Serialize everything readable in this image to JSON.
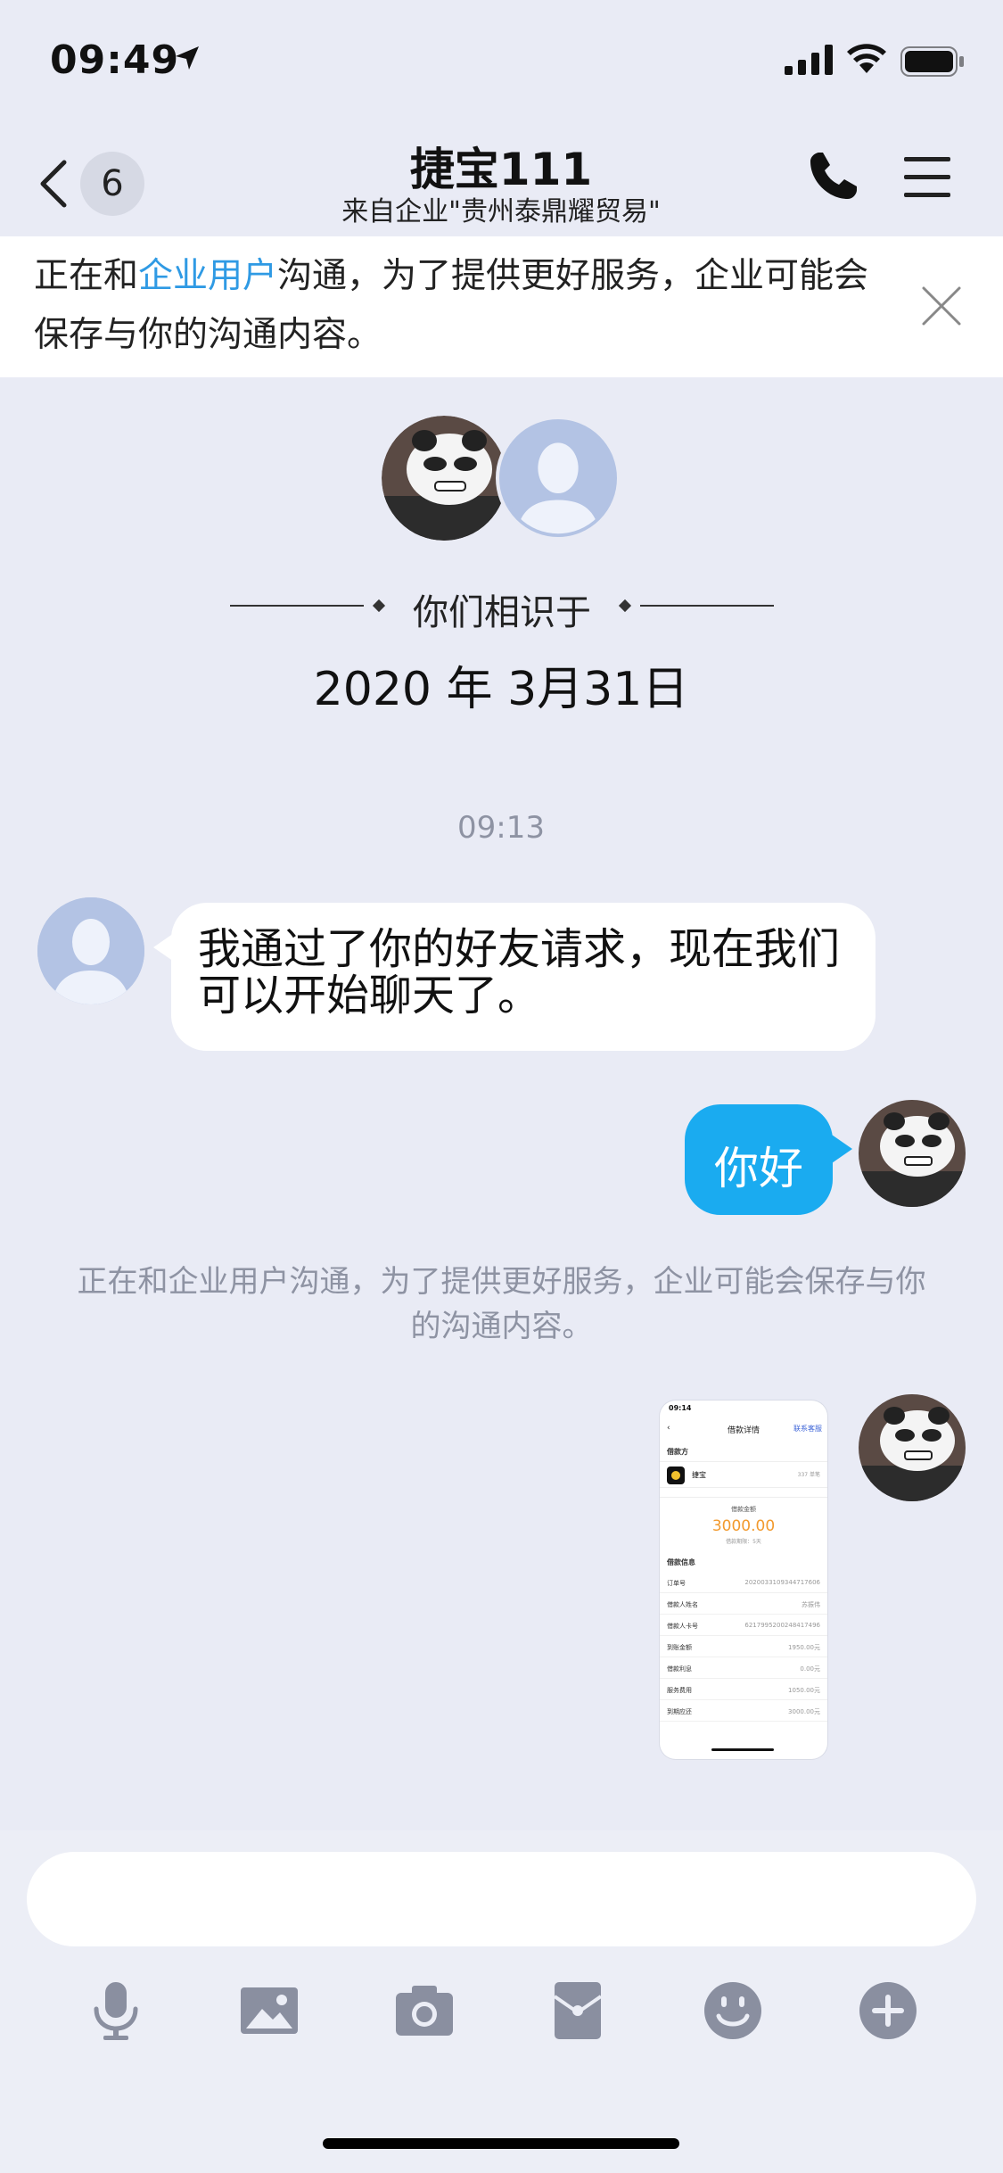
{
  "status_bar": {
    "time": "09:49"
  },
  "nav": {
    "unread_count": "6",
    "title": "捷宝111",
    "subtitle": "来自企业\"贵州泰鼎耀贸易\""
  },
  "notice": {
    "prefix": "正在和",
    "link": "企业用户",
    "suffix": "沟通，为了提供更好服务，企业可能会保存与你的沟通内容。"
  },
  "met": {
    "label": "你们相识于",
    "date": "2020 年 3月31日"
  },
  "chat": {
    "timestamp": "09:13",
    "incoming_message": "我通过了你的好友请求，现在我们可以开始聊天了。",
    "outgoing_message": "你好",
    "system_note": "正在和企业用户沟通，为了提供更好服务，企业可能会保存与你的沟通内容。"
  },
  "shared_screenshot": {
    "status_time": "09:14",
    "title": "借款详情",
    "action": "联系客服",
    "section_lender": "借款方",
    "lender_name": "捷宝",
    "lender_score": "337 单笔",
    "amount_label": "借款金额",
    "amount": "3000.00",
    "amount_note": "借款期限：5天",
    "section_info": "借款信息",
    "rows": [
      {
        "k": "订单号",
        "v": "2020033109344717606"
      },
      {
        "k": "借款人姓名",
        "v": "苏振伟"
      },
      {
        "k": "借款人卡号",
        "v": "6217995200248417496"
      },
      {
        "k": "到账金额",
        "v": "1950.00元"
      },
      {
        "k": "借款利息",
        "v": "0.00元"
      },
      {
        "k": "服务费用",
        "v": "1050.00元"
      },
      {
        "k": "到期应还",
        "v": "3000.00元"
      }
    ]
  },
  "input": {
    "placeholder": ""
  },
  "toolbar": [
    "microphone-icon",
    "image-icon",
    "camera-icon",
    "red-packet-icon",
    "emoji-icon",
    "plus-icon"
  ],
  "colors": {
    "accent": "#1aabf0",
    "link": "#2f9ae4",
    "background": "#e9ebf5",
    "icon": "#8a8fa0"
  }
}
